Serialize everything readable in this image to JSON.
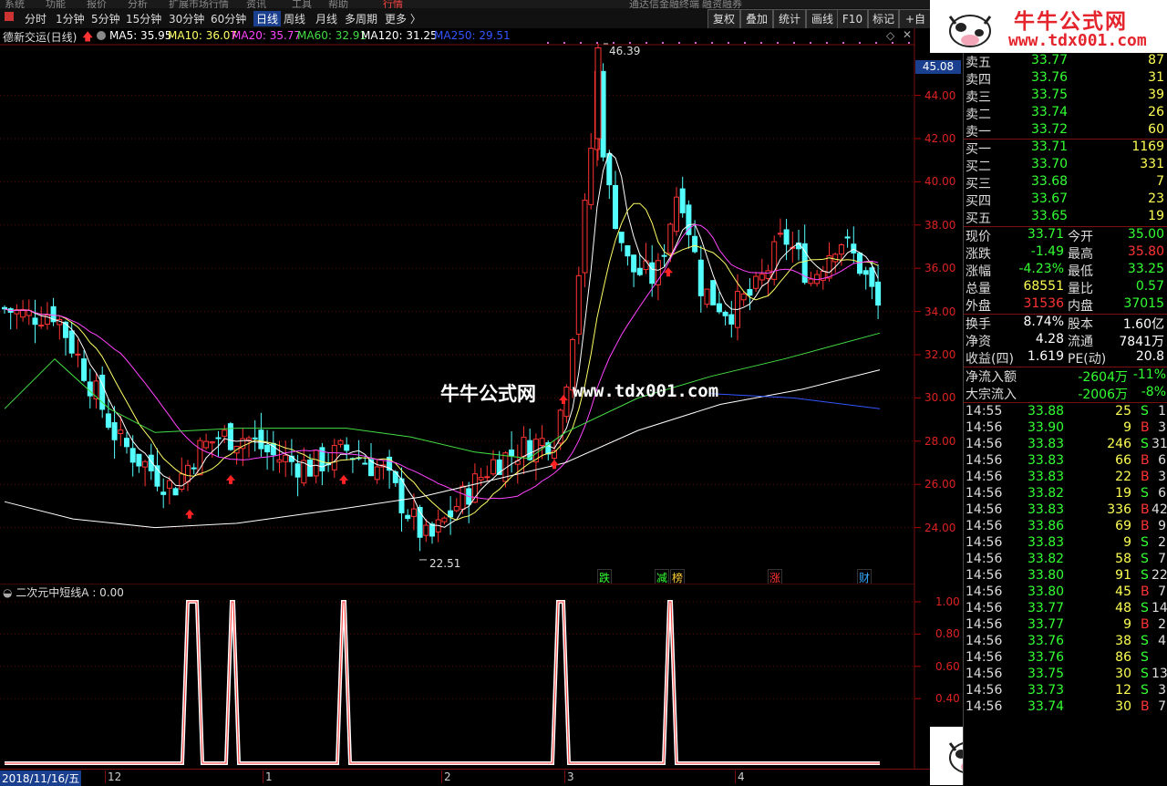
{
  "menubar": {
    "items": [
      "系统",
      "功能",
      "报价",
      "分析",
      "扩展市场行情",
      "资讯",
      "工具",
      "帮助",
      "行情",
      "通达信金融终端",
      "融资融券"
    ]
  },
  "toolbar": {
    "periods": [
      "分时",
      "1分钟",
      "5分钟",
      "15分钟",
      "30分钟",
      "60分钟",
      "日线",
      "周线",
      "月线",
      "多周期",
      "更多 〉"
    ],
    "active": "日线",
    "right_buttons": [
      "复权",
      "叠加",
      "统计",
      "画线",
      "F10",
      "标记",
      "+自选"
    ]
  },
  "ma_legend": {
    "stock": "德新交运(日线)",
    "items": [
      {
        "label": "MA5: 35.95",
        "color": "#ffffff"
      },
      {
        "label": "MA10: 36.07",
        "color": "#ffff66"
      },
      {
        "label": "MA20: 35.77",
        "color": "#ff44ff"
      },
      {
        "label": "MA60: 32.91",
        "color": "#44dd44"
      },
      {
        "label": "MA120: 31.25",
        "color": "#ffffff"
      },
      {
        "label": "MA250: 29.51",
        "color": "#3355ff"
      }
    ]
  },
  "price_axis": {
    "current_tag": "45.08",
    "labels": [
      "44.00",
      "42.00",
      "40.00",
      "38.00",
      "36.00",
      "34.00",
      "32.00",
      "30.00",
      "28.00",
      "26.00",
      "24.00"
    ]
  },
  "annotations": {
    "high": "46.39",
    "low": "22.51"
  },
  "events": [
    {
      "text": "跌",
      "color": "#33ff33"
    },
    {
      "text": "减",
      "color": "#33ff33"
    },
    {
      "text": "榜",
      "color": "#ffcc33"
    },
    {
      "text": "涨",
      "color": "#ff3333"
    },
    {
      "text": "财",
      "color": "#33aaff"
    }
  ],
  "indicator": {
    "title": "二次元中短线A : 0.00",
    "axis_labels": [
      "1.00",
      "0.80",
      "0.60",
      "0.40"
    ]
  },
  "date_axis": {
    "start": "2018/11/16/五",
    "months": [
      "12",
      "1",
      "2",
      "3",
      "4"
    ]
  },
  "watermark": {
    "name": "牛牛公式网",
    "url": "www.tdx001.com"
  },
  "logo": {
    "name": "牛牛公式网",
    "url": "www.tdx001.com"
  },
  "quote": {
    "asks": [
      {
        "label": "卖五",
        "price": "33.77",
        "vol": "87"
      },
      {
        "label": "卖四",
        "price": "33.76",
        "vol": "31"
      },
      {
        "label": "卖三",
        "price": "33.75",
        "vol": "39"
      },
      {
        "label": "卖二",
        "price": "33.74",
        "vol": "26"
      },
      {
        "label": "卖一",
        "price": "33.72",
        "vol": "60"
      }
    ],
    "bids": [
      {
        "label": "买一",
        "price": "33.71",
        "vol": "1169"
      },
      {
        "label": "买二",
        "price": "33.70",
        "vol": "331"
      },
      {
        "label": "买三",
        "price": "33.68",
        "vol": "7"
      },
      {
        "label": "买四",
        "price": "33.67",
        "vol": "23"
      },
      {
        "label": "买五",
        "price": "33.65",
        "vol": "19"
      }
    ],
    "stats": [
      {
        "l1": "现价",
        "v1": "33.71",
        "c1": "#33ff33",
        "l2": "今开",
        "v2": "35.00",
        "c2": "#33ff33"
      },
      {
        "l1": "涨跌",
        "v1": "-1.49",
        "c1": "#33ff33",
        "l2": "最高",
        "v2": "35.80",
        "c2": "#ff3333"
      },
      {
        "l1": "涨幅",
        "v1": "-4.23%",
        "c1": "#33ff33",
        "l2": "最低",
        "v2": "33.25",
        "c2": "#33ff33"
      },
      {
        "l1": "总量",
        "v1": "68551",
        "c1": "#ffff55",
        "l2": "量比",
        "v2": "0.57",
        "c2": "#33ff33"
      },
      {
        "l1": "外盘",
        "v1": "31536",
        "c1": "#ff3333",
        "l2": "内盘",
        "v2": "37015",
        "c2": "#33ff33"
      }
    ],
    "stats2": [
      {
        "l1": "换手",
        "v1": "8.74%",
        "c1": "#ffffff",
        "l2": "股本",
        "v2": "1.60亿",
        "c2": "#ffffff"
      },
      {
        "l1": "净资",
        "v1": "4.28",
        "c1": "#ffffff",
        "l2": "流通",
        "v2": "7841万",
        "c2": "#ffffff"
      },
      {
        "l1": "收益(四)",
        "v1": "1.619",
        "c1": "#ffffff",
        "l2": "PE(动)",
        "v2": "20.8",
        "c2": "#ffffff"
      }
    ],
    "flows": [
      {
        "label": "净流入额",
        "v1": "-2604万",
        "v2": "-11%"
      },
      {
        "label": "大宗流入",
        "v1": "-2006万",
        "v2": "-8%"
      }
    ]
  },
  "ticks": [
    {
      "t": "14:55",
      "p": "33.88",
      "v": "25",
      "s": "S",
      "n": "1"
    },
    {
      "t": "14:56",
      "p": "33.90",
      "v": "9",
      "s": "B",
      "n": "3"
    },
    {
      "t": "14:56",
      "p": "33.83",
      "v": "246",
      "s": "S",
      "n": "31"
    },
    {
      "t": "14:56",
      "p": "33.83",
      "v": "66",
      "s": "B",
      "n": "6"
    },
    {
      "t": "14:56",
      "p": "33.83",
      "v": "22",
      "s": "B",
      "n": "3"
    },
    {
      "t": "14:56",
      "p": "33.82",
      "v": "19",
      "s": "S",
      "n": "6"
    },
    {
      "t": "14:56",
      "p": "33.83",
      "v": "336",
      "s": "B",
      "n": "42"
    },
    {
      "t": "14:56",
      "p": "33.86",
      "v": "69",
      "s": "B",
      "n": "9"
    },
    {
      "t": "14:56",
      "p": "33.83",
      "v": "9",
      "s": "S",
      "n": "2"
    },
    {
      "t": "14:56",
      "p": "33.82",
      "v": "58",
      "s": "S",
      "n": "7"
    },
    {
      "t": "14:56",
      "p": "33.80",
      "v": "91",
      "s": "S",
      "n": "22"
    },
    {
      "t": "14:56",
      "p": "33.80",
      "v": "45",
      "s": "B",
      "n": "7"
    },
    {
      "t": "14:56",
      "p": "33.77",
      "v": "48",
      "s": "S",
      "n": "14"
    },
    {
      "t": "14:56",
      "p": "33.77",
      "v": "9",
      "s": "B",
      "n": "2"
    },
    {
      "t": "14:56",
      "p": "33.76",
      "v": "38",
      "s": "S",
      "n": "4"
    },
    {
      "t": "14:56",
      "p": "33.76",
      "v": "86",
      "s": "S",
      "n": ""
    },
    {
      "t": "14:56",
      "p": "33.75",
      "v": "30",
      "s": "S",
      "n": "13"
    },
    {
      "t": "14:56",
      "p": "33.73",
      "v": "12",
      "s": "S",
      "n": "3"
    },
    {
      "t": "14:56",
      "p": "33.74",
      "v": "30",
      "s": "B",
      "n": "7"
    }
  ]
}
